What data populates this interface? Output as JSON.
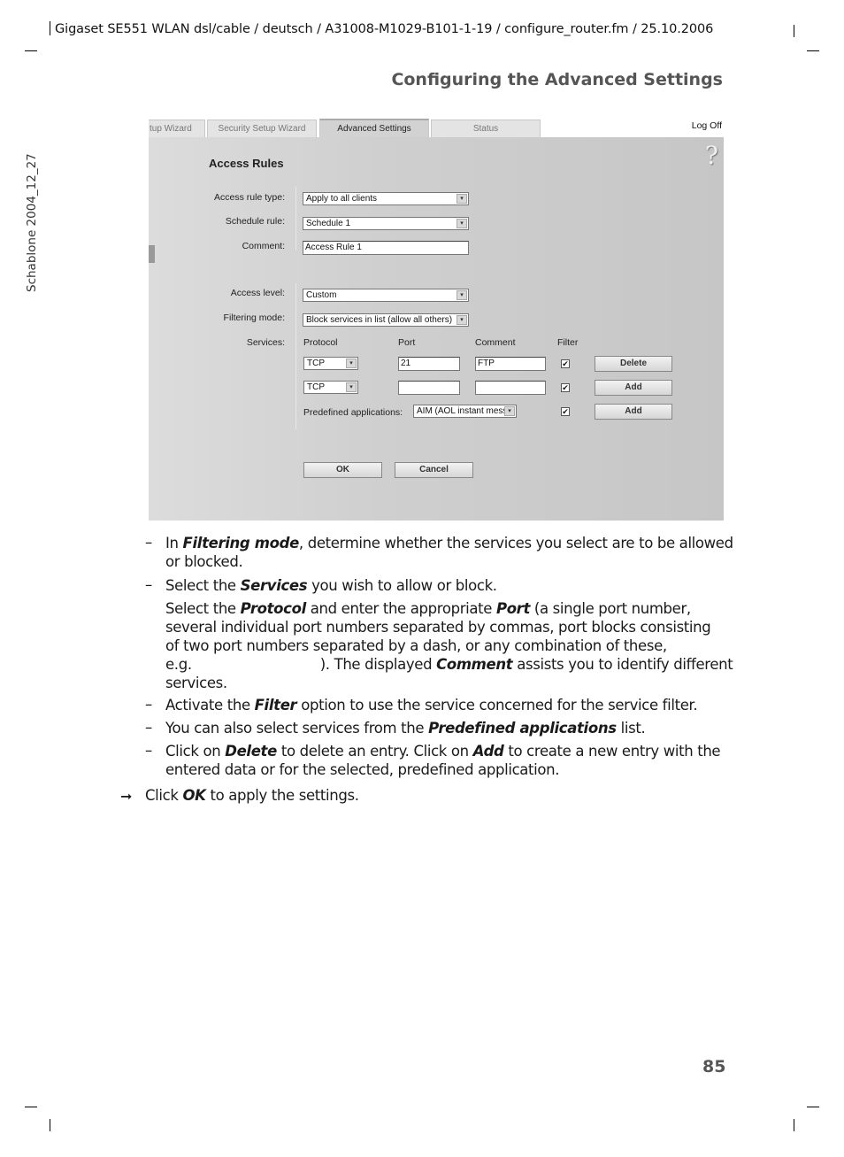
{
  "page_header": {
    "running_head": "Gigaset SE551 WLAN dsl/cable / deutsch / A31008-M1029-B101-1-19 / configure_router.fm / 25.10.2006",
    "section_title": "Configuring the Advanced Settings",
    "side_label": "Schablone 2004_12_27",
    "page_number": "85"
  },
  "screenshot": {
    "tabs": [
      {
        "label": "tup Wizard",
        "active": false
      },
      {
        "label": "Security Setup Wizard",
        "active": false
      },
      {
        "label": "Advanced Settings",
        "active": true
      },
      {
        "label": "Status",
        "active": false
      }
    ],
    "logoff_label": "Log Off",
    "help_icon": "?",
    "title": "Access Rules",
    "fields": {
      "access_rule_type": {
        "label": "Access rule type:",
        "value": "Apply to all clients"
      },
      "schedule_rule": {
        "label": "Schedule rule:",
        "value": "Schedule 1"
      },
      "comment": {
        "label": "Comment:",
        "value": "Access Rule 1"
      },
      "access_level": {
        "label": "Access level:",
        "value": "Custom"
      },
      "filtering_mode": {
        "label": "Filtering mode:",
        "value": "Block services in list (allow all others)"
      }
    },
    "services": {
      "label": "Services:",
      "columns": [
        "Protocol",
        "Port",
        "Comment",
        "Filter"
      ],
      "rows": [
        {
          "protocol": "TCP",
          "port": "21",
          "comment": "FTP",
          "filter": true,
          "action": "Delete"
        },
        {
          "protocol": "TCP",
          "port": "",
          "comment": "",
          "filter": true,
          "action": "Add"
        }
      ],
      "predefined": {
        "label": "Predefined applications:",
        "value": "AIM (AOL instant mess",
        "filter": true,
        "action": "Add"
      }
    },
    "buttons": {
      "ok": "OK",
      "cancel": "Cancel"
    },
    "check_glyph": "✔",
    "arrow_glyph": "▾"
  },
  "instructions": {
    "items": [
      {
        "dash": "–",
        "pre": "In ",
        "bold": "Filtering mode",
        "post": ", determine whether the services you select are to be allowed",
        "line2": "or blocked."
      },
      {
        "dash": "–",
        "pre": "Select the ",
        "bold": "Services",
        "post": " you wish to allow or block."
      },
      {
        "p1_pre": "Select the ",
        "p1_b1": "Protocol",
        "p1_mid": " and enter the appropriate ",
        "p1_b2": "Port",
        "p1_post": " (a single port number,",
        "line2": "several individual port numbers separated by commas, port blocks consisting",
        "line3": "of two port numbers separated by a dash, or any combination of these,",
        "line4_pre": "e.g.",
        "line4_mid": "). The displayed ",
        "line4_b": "Comment",
        "line4_post": " assists you to identify different",
        "line5": "services."
      },
      {
        "dash": "–",
        "pre": "Activate the ",
        "bold": "Filter",
        "post": " option to use the service concerned for the service filter."
      },
      {
        "dash": "–",
        "pre": "You can also select services from the ",
        "bold": "Predefined applications",
        "post": " list."
      },
      {
        "dash": "–",
        "pre": "Click on ",
        "bold": "Delete",
        "mid": " to delete an entry. Click on ",
        "bold2": "Add",
        "post": " to create a new entry with the",
        "line2": "entered data or for the selected, predefined application."
      }
    ],
    "final": {
      "arrow": "➞",
      "pre": "Click ",
      "bold": "OK",
      "post": " to apply the settings."
    }
  }
}
